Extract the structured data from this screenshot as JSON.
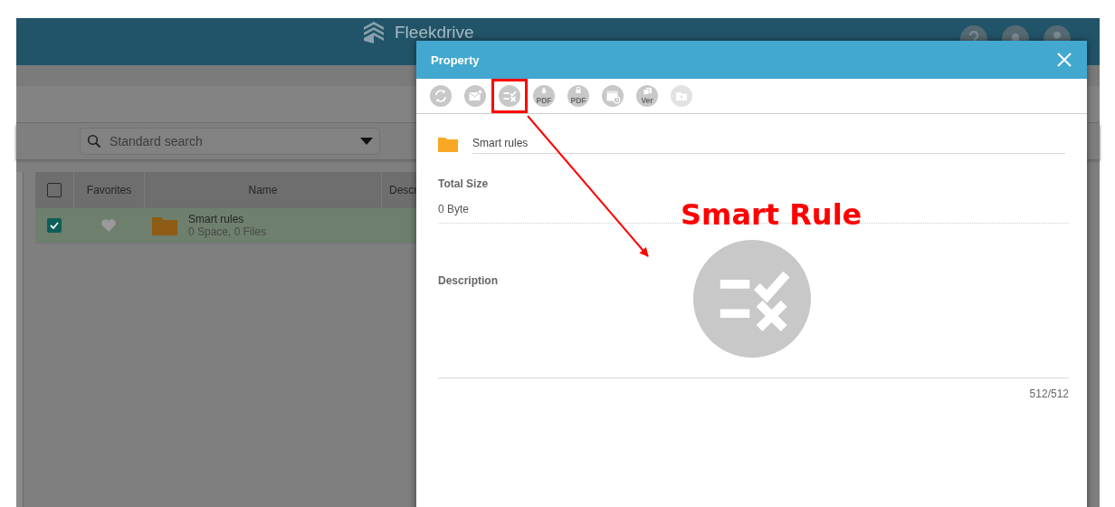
{
  "header": {
    "logo": "Fleekdrive"
  },
  "search": {
    "placeholder": "Standard search"
  },
  "table": {
    "header_checked": false,
    "columns": [
      {
        "label": "Favorites"
      },
      {
        "label": "Name"
      },
      {
        "label": "Descr"
      }
    ],
    "rows": [
      {
        "checked": true,
        "selected": true,
        "favorite": false,
        "name": "Smart rules",
        "meta": "0 Space, 0 Files"
      }
    ]
  },
  "dialog": {
    "title": "Property",
    "tools": [
      {
        "kind": "sync",
        "disabled": false,
        "highlighted": false
      },
      {
        "kind": "mail",
        "disabled": false,
        "highlighted": false
      },
      {
        "kind": "rule",
        "disabled": false,
        "highlighted": true
      },
      {
        "kind": "watermark",
        "label": "PDF",
        "disabled": false,
        "highlighted": false
      },
      {
        "kind": "lock",
        "label": "PDF",
        "disabled": false,
        "highlighted": false
      },
      {
        "kind": "schedule",
        "disabled": false,
        "highlighted": false
      },
      {
        "kind": "version",
        "label": "Ver",
        "disabled": false,
        "highlighted": false
      },
      {
        "kind": "folder",
        "disabled": true,
        "highlighted": false
      }
    ],
    "name_value": "Smart rules",
    "size_label": "Total Size",
    "size_value": "0 Byte",
    "description_label": "Description",
    "counter": "512/512"
  },
  "annotation": {
    "label": "Smart Rule"
  }
}
